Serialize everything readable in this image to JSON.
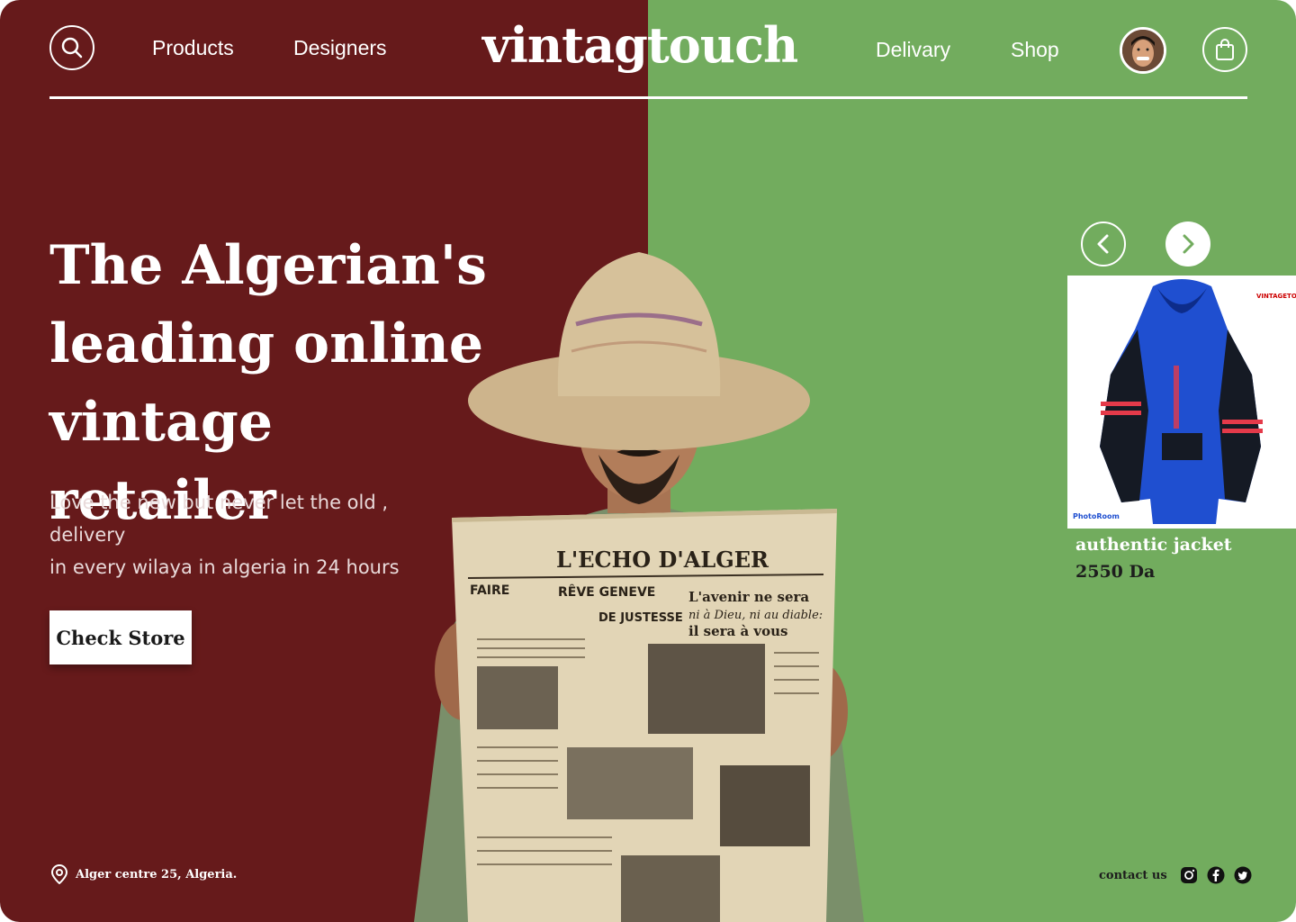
{
  "header": {
    "nav_left": [
      "Products",
      "Designers"
    ],
    "logo": "vintagtouch",
    "nav_right": [
      "Delivary",
      "Shop"
    ]
  },
  "hero": {
    "headline_lines": [
      "The Algerian's",
      "leading online",
      "vintage retailer"
    ],
    "subtitle_lines": [
      "Love the new but never let the old , delivery",
      "in every wilaya in algeria in 24 hours"
    ],
    "cta_label": "Check Store"
  },
  "newspaper": {
    "masthead": "L'ECHO D'ALGER",
    "headlines": [
      "FAIRE",
      "RÊVE GENEVE",
      "DE JUSTESSE",
      "L'avenir ne sera",
      "ni à Dieu, ni au diable:",
      "il sera à vous"
    ]
  },
  "product": {
    "name": "authentic jacket",
    "price": "2550 Da",
    "badge_text": "VINTAGETOUCH",
    "watermark": "PhotoRoom"
  },
  "footer": {
    "address": "Alger centre 25, Algeria.",
    "contact_label": "contact us",
    "social": [
      "instagram-icon",
      "facebook-icon",
      "twitter-icon"
    ]
  },
  "colors": {
    "left_bg": "#661a1b",
    "right_bg": "#72ac5e"
  }
}
